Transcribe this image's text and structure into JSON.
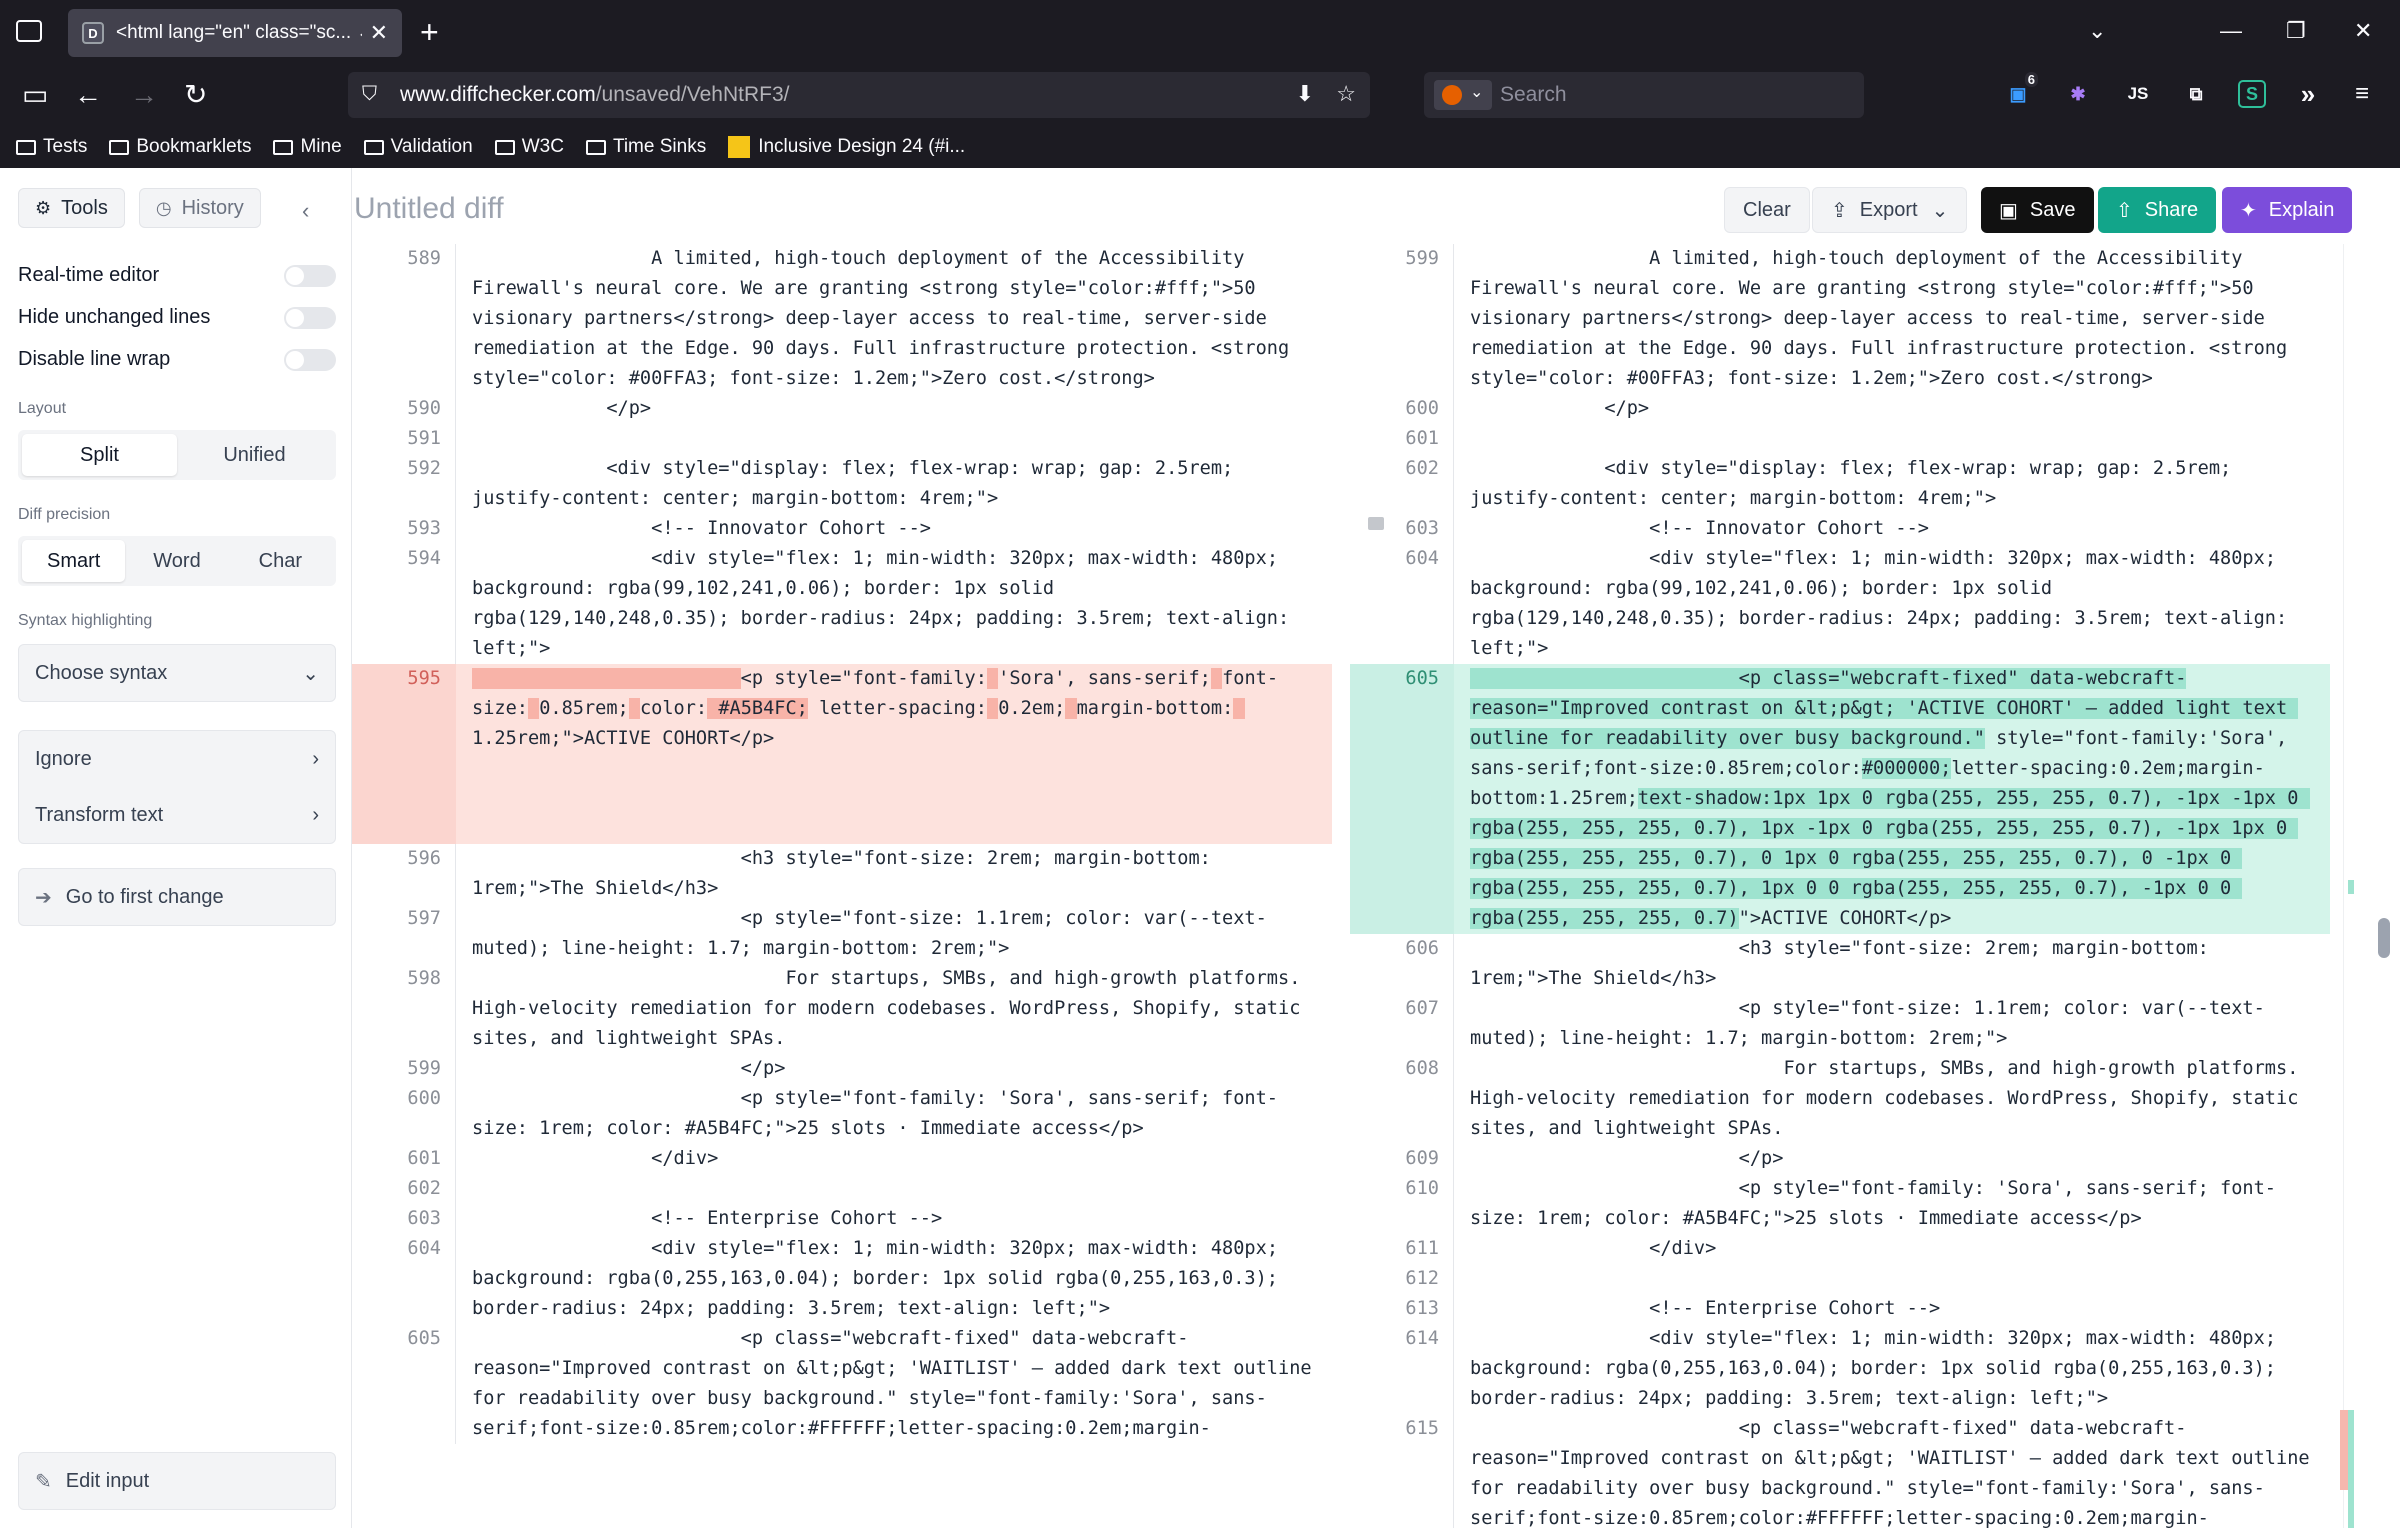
{
  "browser": {
    "tab_title": "<html lang=\"en\" class=\"sc... ↔",
    "tab_favicon": "D",
    "url_domain": "www.diffchecker.com",
    "url_path": "/unsaved/VehNtRF3/",
    "search_placeholder": "Search",
    "extension_badge": "6",
    "bookmarks": [
      "Tests",
      "Bookmarklets",
      "Mine",
      "Validation",
      "W3C",
      "Time Sinks",
      "Inclusive Design 24 (#i..."
    ]
  },
  "sidebar": {
    "tools_label": "Tools",
    "history_label": "History",
    "toggles": [
      "Real-time editor",
      "Hide unchanged lines",
      "Disable line wrap"
    ],
    "layout_label": "Layout",
    "layout_options": [
      "Split",
      "Unified"
    ],
    "precision_label": "Diff precision",
    "precision_options": [
      "Smart",
      "Word",
      "Char"
    ],
    "syntax_label": "Syntax highlighting",
    "syntax_value": "Choose syntax",
    "ignore_label": "Ignore",
    "transform_label": "Transform text",
    "first_change_label": "Go to first change",
    "edit_input_label": "Edit input"
  },
  "header": {
    "title": "Untitled diff",
    "clear_label": "Clear",
    "export_label": "Export",
    "save_label": "Save",
    "share_label": "Share",
    "explain_label": "Explain"
  },
  "colors": {
    "deleted_bg": "#fde2dd",
    "added_bg": "#d4f4ea",
    "share": "#12a58a",
    "explain": "#7c4ddb"
  },
  "diff": {
    "left": [
      {
        "ln": "589",
        "segs": [
          {
            "t": "                A limited, high-touch deployment of the Accessibility Firewall's neural core. We are granting <strong style=\"color:#fff;\">50 visionary partners</strong> deep-layer access to real-time, server-side remediation at the Edge. 90 days. Full infrastructure protection. <strong style=\"color: #00FFA3; font-size: 1.2em;\">Zero cost.</strong>"
          }
        ]
      },
      {
        "ln": "590",
        "segs": [
          {
            "t": "            </p>"
          }
        ]
      },
      {
        "ln": "591",
        "segs": [
          {
            "t": ""
          }
        ]
      },
      {
        "ln": "592",
        "segs": [
          {
            "t": "            <div style=\"display: flex; flex-wrap: wrap; gap: 2.5rem; justify-content: center; margin-bottom: 4rem;\">"
          }
        ]
      },
      {
        "ln": "593",
        "segs": [
          {
            "t": "                <!-- Innovator Cohort -->"
          }
        ]
      },
      {
        "ln": "594",
        "segs": [
          {
            "t": "                <div style=\"flex: 1; min-width: 320px; max-width: 480px; background: rgba(99,102,241,0.06); border: 1px solid rgba(129,140,248,0.35); border-radius: 24px; padding: 3.5rem; text-align: left;\">"
          }
        ]
      },
      {
        "ln": "595",
        "type": "del",
        "pad": 3,
        "segs": [
          {
            "t": "                        ",
            "hl": true
          },
          {
            "t": "<p style=\"font-family:"
          },
          {
            "t": " ",
            "hl": true
          },
          {
            "t": "'Sora', sans-serif;"
          },
          {
            "t": " ",
            "hl": true
          },
          {
            "t": "font-size:"
          },
          {
            "t": " ",
            "hl": true
          },
          {
            "t": "0.85rem;"
          },
          {
            "t": " ",
            "hl": true
          },
          {
            "t": "color:"
          },
          {
            "t": " #A5B4FC;",
            "hl": true
          },
          {
            "t": " letter-spacing:"
          },
          {
            "t": " ",
            "hl": true
          },
          {
            "t": "0.2em;"
          },
          {
            "t": " ",
            "hl": true
          },
          {
            "t": "margin-bottom:"
          },
          {
            "t": " ",
            "hl": true
          },
          {
            "t": "1.25rem;\">ACTIVE COHORT</p>"
          }
        ]
      },
      {
        "ln": "596",
        "segs": [
          {
            "t": "                        <h3 style=\"font-size: 2rem; margin-bottom: 1rem;\">The Shield</h3>"
          }
        ]
      },
      {
        "ln": "597",
        "segs": [
          {
            "t": "                        <p style=\"font-size: 1.1rem; color: var(--text-muted); line-height: 1.7; margin-bottom: 2rem;\">"
          }
        ]
      },
      {
        "ln": "598",
        "segs": [
          {
            "t": "                            For startups, SMBs, and high-growth platforms. High-velocity remediation for modern codebases. WordPress, Shopify, static sites, and lightweight SPAs."
          }
        ]
      },
      {
        "ln": "599",
        "segs": [
          {
            "t": "                        </p>"
          }
        ]
      },
      {
        "ln": "600",
        "segs": [
          {
            "t": "                        <p style=\"font-family: 'Sora', sans-serif; font-size: 1rem; color: #A5B4FC;\">25 slots · Immediate access</p>"
          }
        ]
      },
      {
        "ln": "601",
        "segs": [
          {
            "t": "                </div>"
          }
        ]
      },
      {
        "ln": "602",
        "segs": [
          {
            "t": ""
          }
        ]
      },
      {
        "ln": "603",
        "segs": [
          {
            "t": "                <!-- Enterprise Cohort -->"
          }
        ]
      },
      {
        "ln": "604",
        "segs": [
          {
            "t": "                <div style=\"flex: 1; min-width: 320px; max-width: 480px; background: rgba(0,255,163,0.04); border: 1px solid rgba(0,255,163,0.3); border-radius: 24px; padding: 3.5rem; text-align: left;\">"
          }
        ]
      },
      {
        "ln": "605",
        "segs": [
          {
            "t": "                        <p class=\"webcraft-fixed\" data-webcraft-reason=\"Improved contrast on &lt;p&gt; 'WAITLIST' — added dark text outline for readability over busy background.\" style=\"font-family:'Sora', sans-serif;font-size:0.85rem;color:#FFFFFF;letter-spacing:0.2em;margin-"
          }
        ]
      }
    ],
    "right": [
      {
        "ln": "599",
        "segs": [
          {
            "t": "                A limited, high-touch deployment of the Accessibility Firewall's neural core. We are granting <strong style=\"color:#fff;\">50 visionary partners</strong> deep-layer access to real-time, server-side remediation at the Edge. 90 days. Full infrastructure protection. <strong style=\"color: #00FFA3; font-size: 1.2em;\">Zero cost.</strong>"
          }
        ]
      },
      {
        "ln": "600",
        "segs": [
          {
            "t": "            </p>"
          }
        ]
      },
      {
        "ln": "601",
        "segs": [
          {
            "t": ""
          }
        ]
      },
      {
        "ln": "602",
        "segs": [
          {
            "t": "            <div style=\"display: flex; flex-wrap: wrap; gap: 2.5rem; justify-content: center; margin-bottom: 4rem;\">"
          }
        ]
      },
      {
        "ln": "603",
        "segs": [
          {
            "t": "                <!-- Innovator Cohort -->"
          }
        ]
      },
      {
        "ln": "604",
        "segs": [
          {
            "t": "                <div style=\"flex: 1; min-width: 320px; max-width: 480px; background: rgba(99,102,241,0.06); border: 1px solid rgba(129,140,248,0.35); border-radius: 24px; padding: 3.5rem; text-align: left;\">"
          }
        ]
      },
      {
        "ln": "605",
        "type": "add",
        "segs": [
          {
            "t": "                        <p class=\"webcraft-fixed\" data-webcraft-reason=\"Improved contrast on &lt;p&gt; 'ACTIVE COHORT' — added light text outline for readability over busy background.\"",
            "hl": true
          },
          {
            "t": " style=\"font-family:'Sora', sans-serif;font-size:0.85rem;color:"
          },
          {
            "t": "#000000;",
            "hl": true
          },
          {
            "t": "letter-spacing:0.2em;margin-bottom:1.25rem;"
          },
          {
            "t": "text-shadow:1px 1px 0 rgba(255, 255, 255, 0.7), -1px -1px 0 rgba(255, 255, 255, 0.7), 1px -1px 0 rgba(255, 255, 255, 0.7), -1px 1px 0 rgba(255, 255, 255, 0.7), 0 1px 0 rgba(255, 255, 255, 0.7), 0 -1px 0 rgba(255, 255, 255, 0.7), 1px 0 0 rgba(255, 255, 255, 0.7), -1px 0 0 rgba(255, 255, 255, 0.7)",
            "hl": true
          },
          {
            "t": "\">ACTIVE COHORT</p>"
          }
        ]
      },
      {
        "ln": "606",
        "segs": [
          {
            "t": "                        <h3 style=\"font-size: 2rem; margin-bottom: 1rem;\">The Shield</h3>"
          }
        ]
      },
      {
        "ln": "607",
        "segs": [
          {
            "t": "                        <p style=\"font-size: 1.1rem; color: var(--text-muted); line-height: 1.7; margin-bottom: 2rem;\">"
          }
        ]
      },
      {
        "ln": "608",
        "segs": [
          {
            "t": "                            For startups, SMBs, and high-growth platforms. High-velocity remediation for modern codebases. WordPress, Shopify, static sites, and lightweight SPAs."
          }
        ]
      },
      {
        "ln": "609",
        "segs": [
          {
            "t": "                        </p>"
          }
        ]
      },
      {
        "ln": "610",
        "segs": [
          {
            "t": "                        <p style=\"font-family: 'Sora', sans-serif; font-size: 1rem; color: #A5B4FC;\">25 slots · Immediate access</p>"
          }
        ]
      },
      {
        "ln": "611",
        "segs": [
          {
            "t": "                </div>"
          }
        ]
      },
      {
        "ln": "612",
        "segs": [
          {
            "t": ""
          }
        ]
      },
      {
        "ln": "613",
        "segs": [
          {
            "t": "                <!-- Enterprise Cohort -->"
          }
        ]
      },
      {
        "ln": "614",
        "segs": [
          {
            "t": "                <div style=\"flex: 1; min-width: 320px; max-width: 480px; background: rgba(0,255,163,0.04); border: 1px solid rgba(0,255,163,0.3); border-radius: 24px; padding: 3.5rem; text-align: left;\">"
          }
        ]
      },
      {
        "ln": "615",
        "segs": [
          {
            "t": "                        <p class=\"webcraft-fixed\" data-webcraft-reason=\"Improved contrast on &lt;p&gt; 'WAITLIST' — added dark text outline for readability over busy background.\" style=\"font-family:'Sora', sans-serif;font-size:0.85rem;color:#FFFFFF;letter-spacing:0.2em;margin-"
          }
        ]
      }
    ]
  }
}
